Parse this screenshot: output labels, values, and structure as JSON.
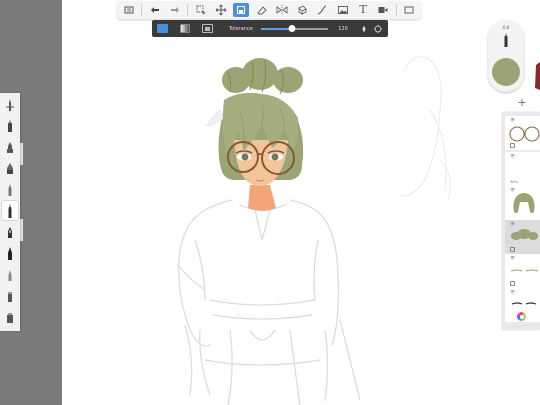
{
  "toolbar": {
    "tools": [
      {
        "name": "gallery-icon"
      },
      {
        "name": "undo-icon"
      },
      {
        "name": "redo-icon"
      },
      {
        "name": "selection-icon"
      },
      {
        "name": "transform-icon"
      },
      {
        "name": "fill-icon",
        "active": true
      },
      {
        "name": "eraser-icon"
      },
      {
        "name": "symmetry-icon"
      },
      {
        "name": "perspective-icon"
      },
      {
        "name": "pen-curve-icon"
      },
      {
        "name": "image-icon"
      },
      {
        "name": "text-icon",
        "label": "T"
      },
      {
        "name": "reference-icon"
      },
      {
        "name": "window-icon"
      }
    ]
  },
  "fill_options": {
    "modes": [
      "solid",
      "gradient",
      "color-layer"
    ],
    "label": "Tolerance",
    "value": "120",
    "tolerance_fraction": 0.47
  },
  "brushes": {
    "count": 11,
    "active_index": 5
  },
  "color_puck": {
    "size_label": "6.8",
    "current_color": "#9aa474"
  },
  "layers": {
    "add_label": "+",
    "opacity_label": "30%"
  },
  "colors": {
    "accent": "#4a8fd8",
    "hair": "#9aa474",
    "glasses": "#8a5a34",
    "skin": "#f3c59b",
    "canvas": "#ffffff"
  }
}
